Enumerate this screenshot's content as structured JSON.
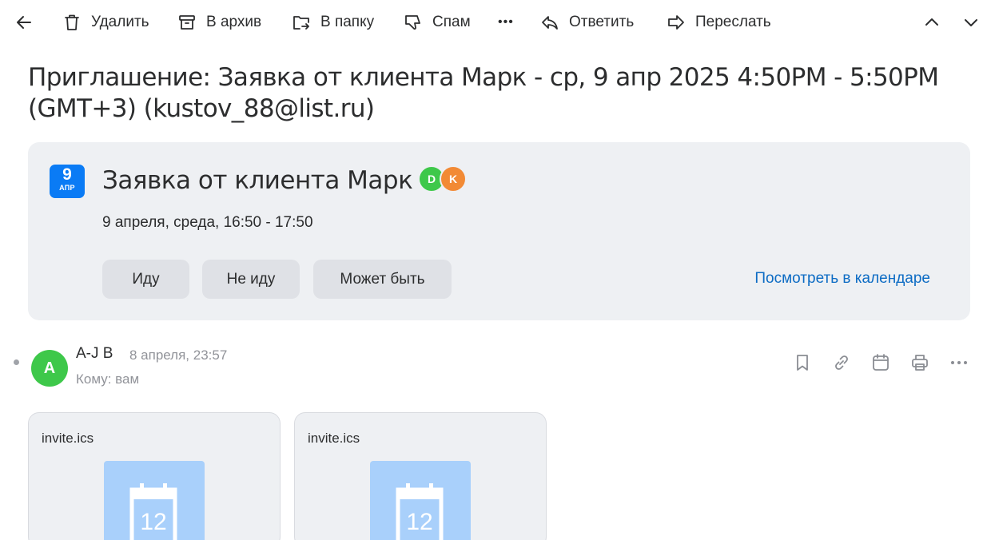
{
  "toolbar": {
    "delete_label": "Удалить",
    "archive_label": "В архив",
    "move_label": "В папку",
    "spam_label": "Спам",
    "more_label": "•••",
    "reply_label": "Ответить",
    "forward_label": "Переслать"
  },
  "subject": "Приглашение: Заявка от клиента Марк - ср, 9 апр 2025 4:50PM - 5:50PM (GMT+3) (kustov_88@list.ru)",
  "event": {
    "badge_day": "9",
    "badge_month": "АПР",
    "title": "Заявка от клиента Марк",
    "attendees": [
      {
        "initial": "D",
        "color": "#3ec84a"
      },
      {
        "initial": "K",
        "color": "#f28a35"
      }
    ],
    "time": "9 апреля, среда, 16:50 - 17:50",
    "rsvp": {
      "going": "Иду",
      "not_going": "Не иду",
      "maybe": "Может быть"
    },
    "calendar_link": "Посмотреть в календаре"
  },
  "message": {
    "avatar_initial": "A",
    "sender": "A-J B",
    "date": "8 апреля, 23:57",
    "recipient": "Кому: вам",
    "actions": [
      "bookmark-icon",
      "link-icon",
      "calendar-icon",
      "print-icon",
      "more-icon"
    ]
  },
  "attachments": [
    {
      "name": "invite.ics",
      "thumb_number": "12"
    },
    {
      "name": "invite.ics",
      "thumb_number": "12"
    }
  ],
  "colors": {
    "accent": "#0a7bf5",
    "link": "#0d6cc4",
    "card_bg": "#eef0f3",
    "button_bg": "#dfe1e6",
    "avatar_green": "#3ec84a",
    "avatar_orange": "#f28a35",
    "ics_thumb": "#a9d0fb"
  }
}
